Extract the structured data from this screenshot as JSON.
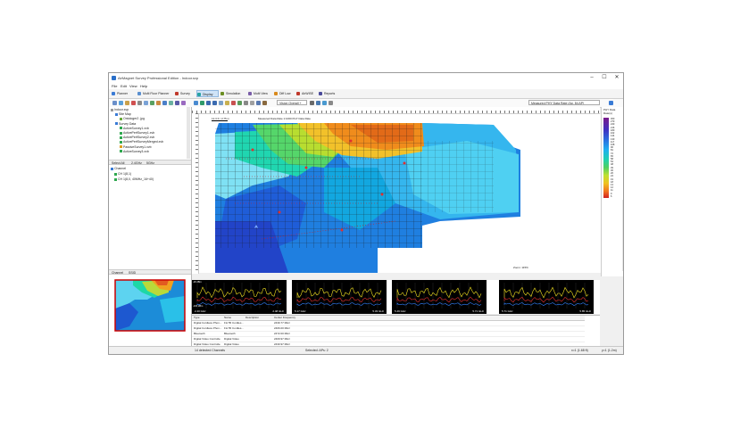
{
  "window": {
    "title": "AirMagnet Survey Professional Edition - Indoor.svp",
    "controls": [
      "–",
      "☐",
      "✕"
    ]
  },
  "menu": [
    "File",
    "Edit",
    "View",
    "Help"
  ],
  "ribbon": [
    {
      "label": "Planner",
      "color": "#3a7bd5"
    },
    {
      "label": "Multi Floor Planner",
      "color": "#5a8fcf"
    },
    {
      "label": "Survey",
      "color": "#c0392b"
    },
    {
      "label": "Display",
      "color": "#27a3a3"
    },
    {
      "label": "Simulation",
      "color": "#6b8e23"
    },
    {
      "label": "Multi View",
      "color": "#7a5ea8"
    },
    {
      "label": "Diff Low",
      "color": "#d98a1d"
    },
    {
      "label": "AirWISE",
      "color": "#c0392b"
    },
    {
      "label": "Reports",
      "color": "#4a4a9a"
    }
  ],
  "toolbar": {
    "view_combo": "Vision Overall +",
    "measure_combo": "Measured PHY Data Rate (Ap, 84 AP)"
  },
  "tree": {
    "items": [
      {
        "label": "Indoor.svp",
        "indent": 0,
        "color": "#999"
      },
      {
        "label": "Site Map",
        "indent": 1,
        "color": "#3a7bd5"
      },
      {
        "label": "Ontologer2 .jpg",
        "indent": 2,
        "color": "#6aaa3a"
      },
      {
        "label": "Survey Data",
        "indent": 1,
        "color": "#3a7bd5"
      },
      {
        "label": "ActiveSurvey1.xvb",
        "indent": 2,
        "color": "#2fa84f"
      },
      {
        "label": "ActivePerfSurvey1.xvb",
        "indent": 2,
        "color": "#2fa84f"
      },
      {
        "label": "ActivePerfSurvey2.xvb",
        "indent": 2,
        "color": "#2fa84f"
      },
      {
        "label": "ActivePerfSurveyMerged.xvb",
        "indent": 2,
        "color": "#2fa84f"
      },
      {
        "label": "PassiveSurvey1.xvb",
        "indent": 2,
        "color": "#e0a020"
      },
      {
        "label": "ActiveSurvey3.xvb",
        "indent": 2,
        "color": "#2fa84f"
      }
    ]
  },
  "filter_bar": {
    "select_all": "Select All",
    "band_24": "2.4GHz",
    "band_5": "5GHz"
  },
  "channel_tree": {
    "root": "Channel",
    "items": [
      "CH 1(8,1)",
      "CH 1(8,0, 40MHz_16+40)"
    ]
  },
  "bottom_tabs": [
    "Channel",
    "SSID"
  ],
  "canvas": {
    "scale_label": "12.3 ft / 3.75 m",
    "rate_label": "Measured Data Rate 1:1000 PHY Data Rate",
    "zoom_label": "Zoom: 115%"
  },
  "legend": {
    "title": "PHY Data Rate(s)",
    "values": [
      "300",
      "270",
      "240",
      "216",
      "180",
      "162",
      "144",
      "130",
      "117",
      "108",
      "90",
      "81",
      "72",
      "65",
      "58",
      "54",
      "48",
      "39",
      "36",
      "26",
      "24",
      "19",
      "18",
      "13",
      "12",
      "11",
      "9",
      "6"
    ]
  },
  "spectra": [
    {
      "y_top": "-20 dBm",
      "y_bot": "-100 dBm",
      "f_start": "2.40 GHz",
      "f_end": "2.48 GHz"
    },
    {
      "y_top": "",
      "y_bot": "",
      "f_start": "5.17 GHz",
      "f_end": "5.33 GHz"
    },
    {
      "y_top": "",
      "y_bot": "",
      "f_start": "5.49 GHz",
      "f_end": "5.71 GHz"
    },
    {
      "y_top": "",
      "y_bot": "",
      "f_start": "5.71 GHz",
      "f_end": "5.85 GHz"
    }
  ],
  "table": {
    "headers": [
      "Type",
      "Name",
      "Description",
      "Center Frequency"
    ],
    "rows": [
      [
        "Digital Cordless Phon...",
        "FH 55 Cordles...",
        "",
        "2439.77 MHz"
      ],
      [
        "Digital Cordless Phon...",
        "FH 55 Cordles...",
        "",
        "2406.00 MHz"
      ],
      [
        "Bluetooth",
        "Bluetooth",
        "",
        "2472.00 MHz"
      ],
      [
        "Digital Video Controlle",
        "Digital Video",
        "",
        "2409.97 MHz"
      ],
      [
        "Digital Video Controlle",
        "Digital Video",
        "",
        "2430.97 MHz"
      ]
    ]
  },
  "status": {
    "left": "14 detected Channels",
    "mid": "Selected: APs: 2",
    "x": "x=1 (1.68 ft)",
    "y": "y=1 (1.2m)"
  }
}
